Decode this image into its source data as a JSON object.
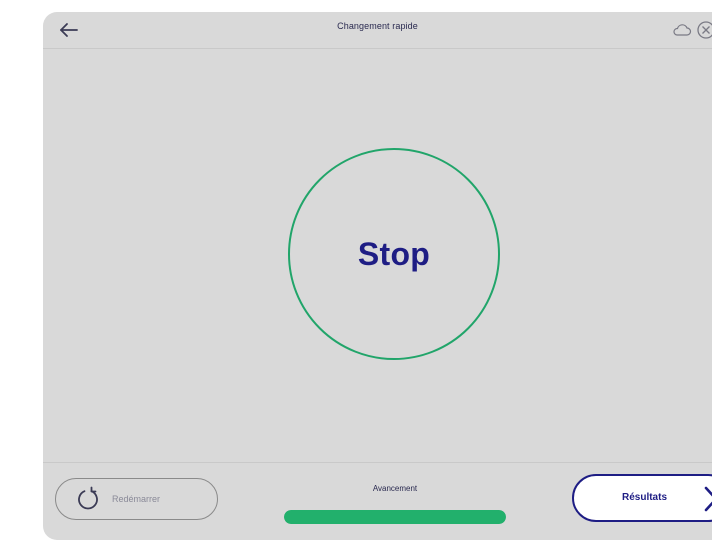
{
  "header": {
    "title": "Changement rapide",
    "back_icon": "arrow-left-icon",
    "cloud_icon": "cloud-icon",
    "close_icon": "close-circle-icon"
  },
  "main": {
    "stop_label": "Stop"
  },
  "footer": {
    "restart_label": "Redémarrer",
    "restart_icon": "restart-icon",
    "progress_label": "Avancement",
    "progress_value": 1.0,
    "results_label": "Résultats",
    "results_icon": "chevron-right-icon"
  },
  "colors": {
    "background": "#d9d9d9",
    "accent_green": "#22b06c",
    "accent_navy": "#1e1d84",
    "muted": "#8a8a8a"
  }
}
